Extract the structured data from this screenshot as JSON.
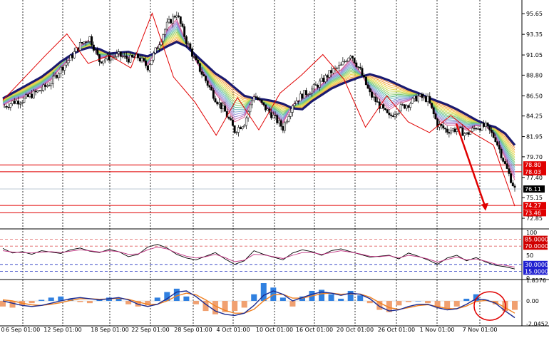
{
  "chart_data": [
    {
      "type": "candlestick",
      "price_ticks": [
        "95.65",
        "93.35",
        "91.05",
        "88.80",
        "86.50",
        "84.25",
        "81.95",
        "79.70",
        "77.40",
        "75.15",
        "72.85"
      ],
      "price_ylim": [
        71.9,
        96.7
      ],
      "current_price": "76.11",
      "horizontal_levels": [
        {
          "label": "78.80",
          "value": 78.8,
          "color": "#e00000"
        },
        {
          "label": "78.03",
          "value": 78.03,
          "color": "#e00000"
        },
        {
          "label": "74.27",
          "value": 74.27,
          "color": "#e00000"
        },
        {
          "label": "73.46",
          "value": 73.46,
          "color": "#e00000"
        }
      ],
      "x_labels": [
        "6 Sep 01:00",
        "12 Sep 01:00",
        "18 Sep 01:00",
        "22 Sep 01:00",
        "28 Sep 01:00",
        "4 Oct 01:00",
        "10 Oct 01:00",
        "16 Oct 01:00",
        "20 Oct 01:00",
        "26 Oct 01:00",
        "1 Nov 01:00",
        "7 Nov 01:00"
      ],
      "x_label_partial": "0",
      "trend_path": [
        86.2,
        86.8,
        87.4,
        88.0,
        88.6,
        89.4,
        90.3,
        91.0,
        91.6,
        91.9,
        91.7,
        91.2,
        91.3,
        91.4,
        91.1,
        90.9,
        91.4,
        92.0,
        92.5,
        92.0,
        91.0,
        90.0,
        89.0,
        88.3,
        87.4,
        86.5,
        86.2,
        86.1,
        85.9,
        85.6,
        85.1,
        85.0,
        85.9,
        86.6,
        87.3,
        87.8,
        88.2,
        88.6,
        88.9,
        88.6,
        88.2,
        87.7,
        87.2,
        86.8,
        86.3,
        85.9,
        85.5,
        85.0,
        84.4,
        83.8,
        83.3,
        83.0,
        82.3,
        81.0
      ],
      "price_path": [
        85.2,
        85.8,
        86.0,
        86.6,
        87.2,
        88.0,
        89.5,
        90.7,
        92.2,
        93.0,
        90.4,
        90.8,
        91.0,
        90.6,
        90.8,
        89.7,
        92.0,
        94.4,
        95.7,
        92.6,
        90.2,
        88.2,
        86.2,
        84.7,
        82.6,
        83.5,
        86.6,
        85.3,
        84.2,
        82.9,
        85.6,
        86.6,
        87.2,
        88.1,
        89.2,
        89.8,
        91.2,
        89.3,
        86.7,
        85.4,
        84.1,
        85.1,
        85.6,
        86.4,
        86.1,
        83.3,
        82.6,
        82.8,
        82.2,
        83.0,
        83.1,
        81.7,
        78.8,
        76.1
      ],
      "red_zigzag_path": [
        86.0,
        88.5,
        91.0,
        93.4,
        90.1,
        91.0,
        89.6,
        95.7,
        88.6,
        85.8,
        82.1,
        86.3,
        82.7,
        86.8,
        88.8,
        91.1,
        88.3,
        83.0,
        86.5,
        83.6,
        82.4,
        84.3,
        82.4,
        81.0,
        74.2
      ],
      "arrows": [
        "final-down-arrow"
      ]
    },
    {
      "type": "line",
      "ticks": [
        "100",
        "85.0000",
        "70.0000",
        "50",
        "30.0000",
        "15.0000",
        "0"
      ],
      "ylim": [
        0,
        100
      ],
      "levels": [
        85,
        70,
        30,
        15
      ],
      "series": [
        {
          "values": [
            65,
            55,
            58,
            52,
            60,
            57,
            54,
            62,
            66,
            59,
            56,
            63,
            58,
            47,
            52,
            68,
            74,
            66,
            52,
            44,
            40,
            48,
            56,
            42,
            30,
            38,
            60,
            52,
            46,
            40,
            55,
            62,
            58,
            50,
            60,
            64,
            58,
            52,
            46,
            48,
            50,
            42,
            55,
            48,
            40,
            30,
            44,
            50,
            38,
            45,
            35,
            28,
            25,
            20
          ]
        },
        {
          "values": [
            60,
            57,
            56,
            55,
            57,
            58,
            56,
            59,
            62,
            60,
            57,
            60,
            58,
            52,
            53,
            62,
            68,
            64,
            55,
            48,
            44,
            47,
            52,
            45,
            36,
            39,
            52,
            51,
            47,
            43,
            50,
            56,
            56,
            52,
            56,
            60,
            57,
            53,
            48,
            47,
            49,
            44,
            50,
            47,
            42,
            35,
            41,
            46,
            40,
            42,
            37,
            31,
            28,
            24
          ]
        }
      ]
    },
    {
      "type": "bar+line",
      "ticks": [
        "1.8576",
        "0.00",
        "-2.0452"
      ],
      "ylim": [
        -2.0452,
        1.8576
      ],
      "histogram": [
        -0.5,
        -0.6,
        -0.4,
        -0.2,
        0.1,
        0.3,
        0.4,
        0.2,
        -0.1,
        -0.2,
        0.1,
        0.3,
        0.2,
        -0.3,
        -0.5,
        -0.4,
        0.3,
        0.8,
        1.1,
        0.4,
        -0.3,
        -0.9,
        -1.2,
        -1.0,
        -0.9,
        -0.6,
        0.6,
        1.6,
        1.2,
        0.3,
        -0.5,
        0.4,
        0.9,
        1.0,
        0.6,
        0.2,
        0.9,
        0.5,
        -0.2,
        -0.8,
        -1.0,
        -0.4,
        -0.1,
        0.0,
        -0.2,
        -0.6,
        -0.7,
        -0.5,
        0.2,
        0.6,
        0.1,
        -0.3,
        -0.9,
        -0.8
      ],
      "macd_line": [
        0.0,
        -0.2,
        -0.4,
        -0.5,
        -0.4,
        -0.2,
        0.0,
        0.2,
        0.3,
        0.2,
        0.1,
        0.2,
        0.3,
        0.1,
        -0.3,
        -0.5,
        -0.3,
        0.2,
        0.8,
        0.9,
        0.4,
        -0.3,
        -0.9,
        -1.2,
        -1.3,
        -1.1,
        -0.4,
        0.5,
        0.9,
        0.6,
        0.0,
        0.3,
        0.6,
        0.8,
        0.7,
        0.5,
        0.7,
        0.6,
        0.2,
        -0.5,
        -0.9,
        -0.8,
        -0.5,
        -0.3,
        -0.3,
        -0.6,
        -0.8,
        -0.7,
        -0.3,
        0.2,
        0.1,
        -0.2,
        -0.9,
        -1.5
      ],
      "signal_line": [
        0.1,
        0.0,
        -0.2,
        -0.35,
        -0.4,
        -0.3,
        -0.15,
        0.05,
        0.2,
        0.2,
        0.15,
        0.18,
        0.24,
        0.15,
        -0.1,
        -0.3,
        -0.3,
        0.0,
        0.45,
        0.7,
        0.55,
        0.1,
        -0.45,
        -0.85,
        -1.1,
        -1.1,
        -0.75,
        0.0,
        0.55,
        0.6,
        0.25,
        0.25,
        0.45,
        0.65,
        0.7,
        0.6,
        0.65,
        0.62,
        0.35,
        -0.15,
        -0.6,
        -0.75,
        -0.6,
        -0.42,
        -0.34,
        -0.5,
        -0.68,
        -0.7,
        -0.45,
        -0.05,
        0.05,
        -0.12,
        -0.6,
        -1.1
      ]
    }
  ]
}
